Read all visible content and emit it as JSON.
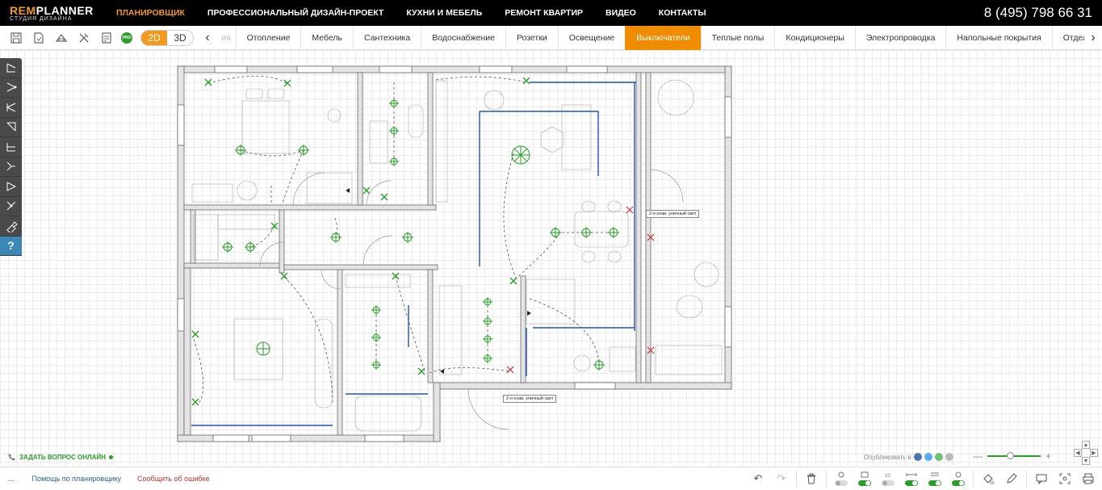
{
  "brand": {
    "name_part1": "REM",
    "name_part2": "PLANNER",
    "tagline": "СТУДИЯ ДИЗАЙНА"
  },
  "top_nav": [
    "ПЛАНИРОВЩИК",
    "ПРОФЕССИОНАЛЬНЫЙ ДИЗАЙН-ПРОЕКТ",
    "КУХНИ И МЕБЕЛЬ",
    "РЕМОНТ КВАРТИР",
    "ВИДЕО",
    "КОНТАКТЫ"
  ],
  "phone": "8 (495) 798 66 31",
  "view_toggle": {
    "d2": "2D",
    "d3": "3D"
  },
  "pro_badge": "PRO",
  "tabs_faded_left": "ия",
  "tabs": [
    "Отопление",
    "Мебель",
    "Сантехника",
    "Водоснабжение",
    "Розетки",
    "Освещение",
    "Выключатели",
    "Теплые полы",
    "Кондиционеры",
    "Электропроводка",
    "Напольные покрытия"
  ],
  "tab_partial": "Отделка сте",
  "active_tab": "Выключатели",
  "callouts": [
    "2-я клав. уличный свет",
    "2-я клав. уличный свет"
  ],
  "help_button": "?",
  "ask_online": "ЗАДАТЬ ВОПРОС ОНЛАЙН",
  "publish_label": "Опубликовать в",
  "zoom": {
    "minus": "—",
    "plus": "+",
    "level": 0.38
  },
  "bottom": {
    "dots": "...",
    "help": "Помощь по планировщику",
    "report": "Сообщить об ошибке"
  },
  "colors": {
    "accent": "#ef8c00",
    "brand_orange": "#f29a1f",
    "switch_green": "#2a9d2a",
    "wire_blue": "#1e50c8"
  }
}
